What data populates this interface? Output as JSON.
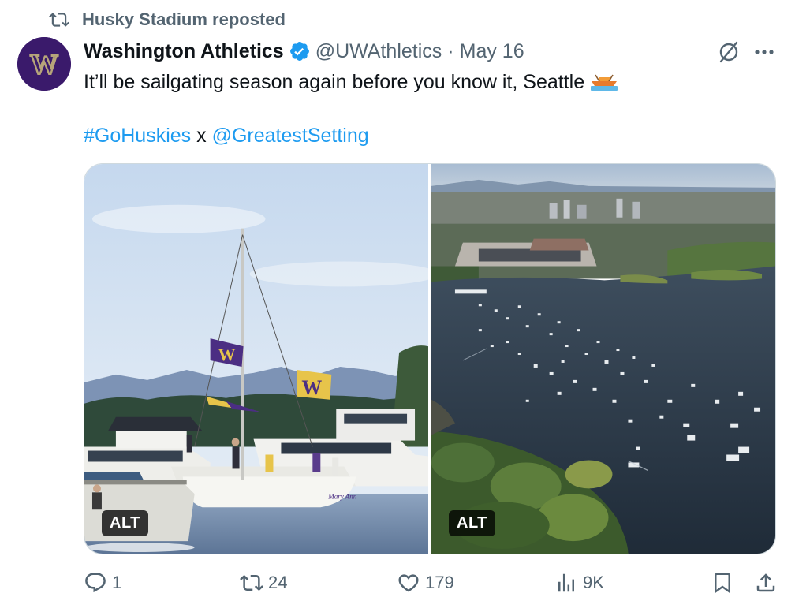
{
  "repost": {
    "text": "Husky Stadium reposted",
    "icon": "repost-icon"
  },
  "author": {
    "avatar_letter": "W",
    "name": "Washington Athletics",
    "verified": true,
    "handle": "@UWAthletics",
    "separator": "·",
    "date": "May 16"
  },
  "tweet": {
    "line1": "It’ll be sailgating season again before you know it, Seattle",
    "emoji": "rowboat-emoji",
    "hashtag": "#GoHuskies",
    "connector": " x ",
    "mention": "@GreatestSetting"
  },
  "media": [
    {
      "alt_label": "ALT",
      "flag_letter": "W",
      "boat_name": "Mary Ann"
    },
    {
      "alt_label": "ALT"
    }
  ],
  "actions": {
    "replies": "1",
    "reposts": "24",
    "likes": "179",
    "views": "9K"
  },
  "colors": {
    "link": "#1d9bf0",
    "muted": "#536471",
    "text": "#0f1419",
    "uw_purple": "#4b2e83",
    "uw_gold": "#b7a57a",
    "verified": "#1d9bf0"
  }
}
